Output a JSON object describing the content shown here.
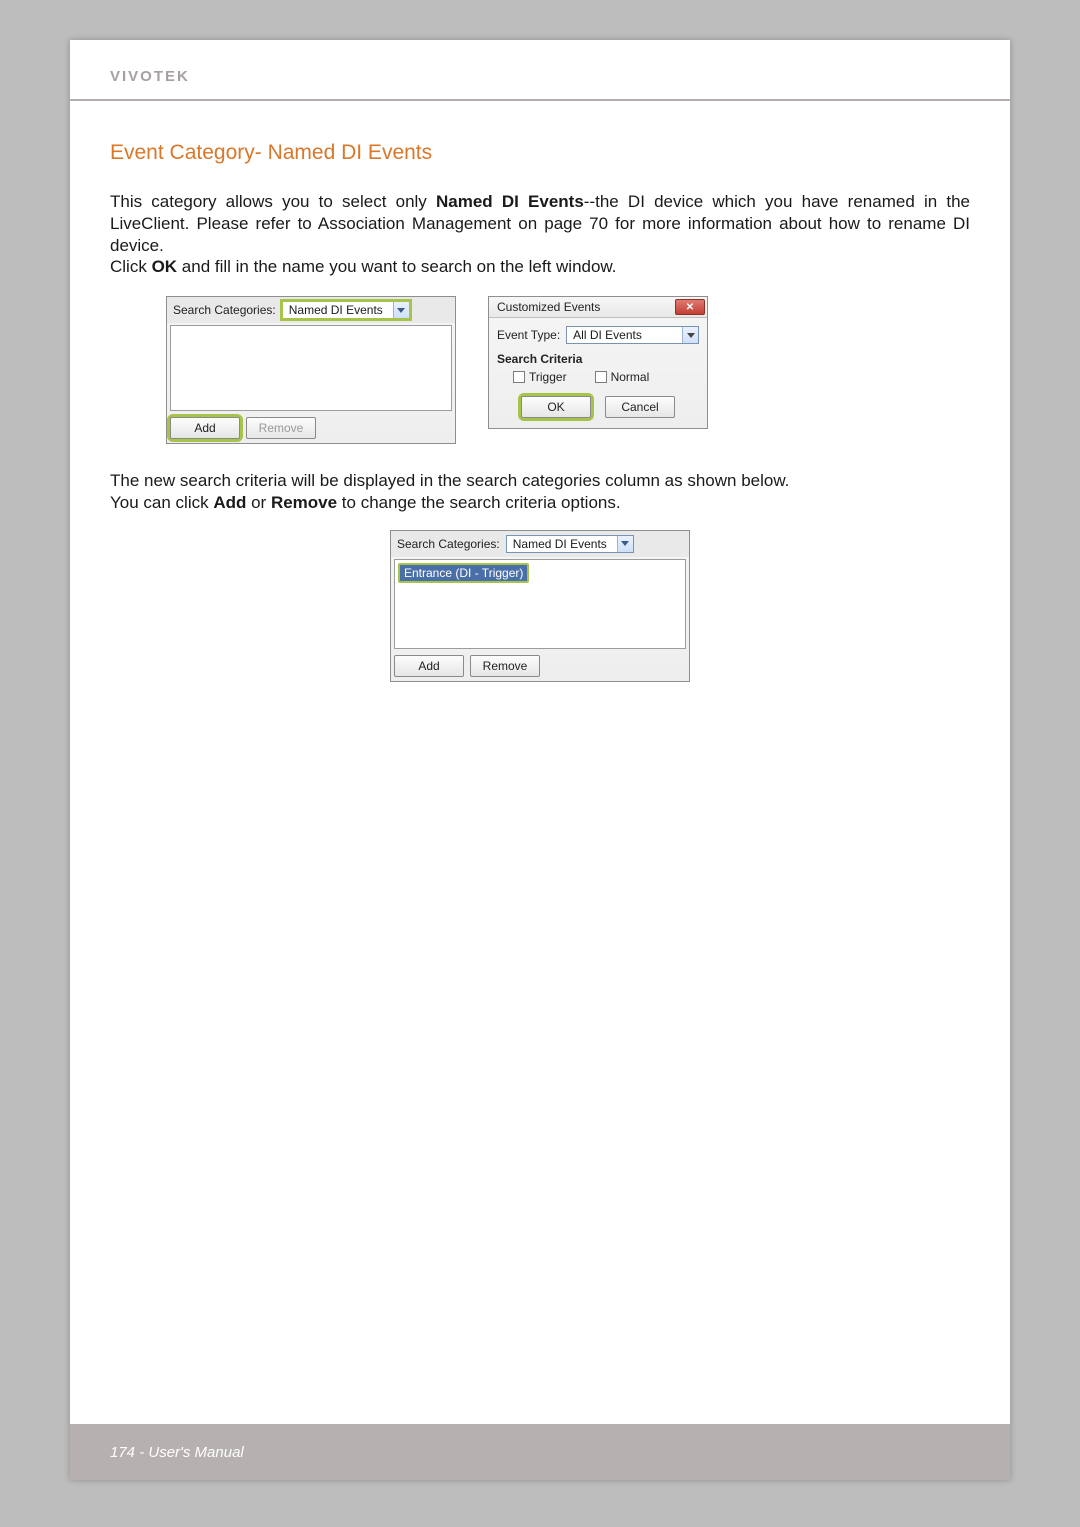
{
  "brand": "VIVOTEK",
  "section_title": "Event Category- Named DI Events",
  "para1_a": "This category allows you to select only ",
  "para1_b": "Named DI Events",
  "para1_c": "--the DI device which you have renamed in the LiveClient. Please refer to Association Management on page 70 for more information about how to rename DI device.",
  "para2_a": "Click ",
  "para2_b": "OK",
  "para2_c": " and fill in the name you want to search on the left window.",
  "para3": "The new search criteria will be displayed in the search categories column as shown below.",
  "para4_a": "You can click ",
  "para4_b": "Add",
  "para4_c": " or ",
  "para4_d": "Remove",
  "para4_e": " to change the search criteria options.",
  "sc": {
    "label": "Search Categories:",
    "combo": "Named DI Events",
    "add": "Add",
    "remove": "Remove"
  },
  "ce": {
    "title": "Customized Events",
    "event_type_label": "Event Type:",
    "event_type_value": "All DI Events",
    "search_criteria": "Search Criteria",
    "trigger": "Trigger",
    "normal": "Normal",
    "ok": "OK",
    "cancel": "Cancel"
  },
  "sc2_entry": "Entrance (DI - Trigger)",
  "footer": "174 - User's Manual"
}
